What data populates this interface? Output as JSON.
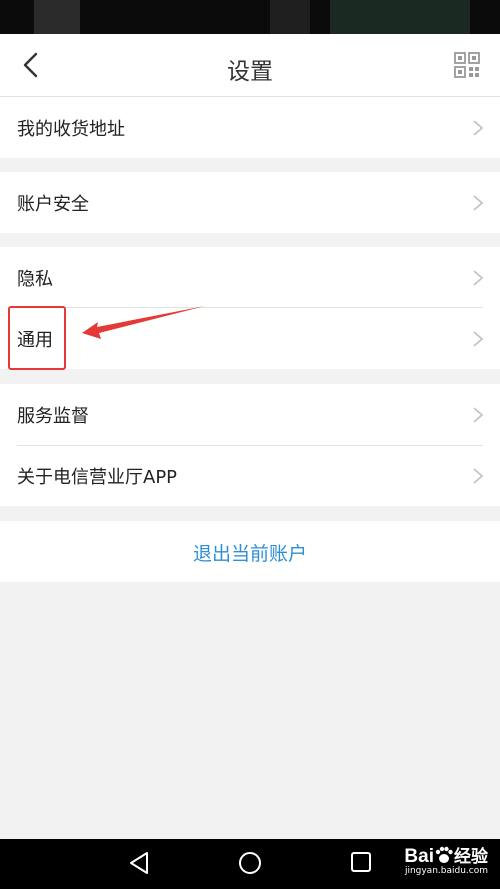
{
  "header": {
    "title": "设置"
  },
  "groups": [
    {
      "items": [
        {
          "label": "我的收货地址"
        }
      ]
    },
    {
      "items": [
        {
          "label": "账户安全"
        }
      ]
    },
    {
      "items": [
        {
          "label": "隐私"
        },
        {
          "label": "通用"
        }
      ]
    },
    {
      "items": [
        {
          "label": "服务监督"
        },
        {
          "label": "关于电信营业厅APP"
        }
      ]
    }
  ],
  "logout": {
    "label": "退出当前账户"
  },
  "colors": {
    "accent": "#2f8fd6",
    "highlight": "#e53935",
    "background": "#f2f2f2"
  },
  "watermark": {
    "brand": "Bai",
    "brand_cn": "经验",
    "url": "jingyan.baidu.com"
  },
  "icons": [
    "back-arrow-icon",
    "qr-code-icon",
    "chevron-right-icon",
    "nav-back-icon",
    "nav-home-icon",
    "nav-recent-icon",
    "paw-icon"
  ]
}
